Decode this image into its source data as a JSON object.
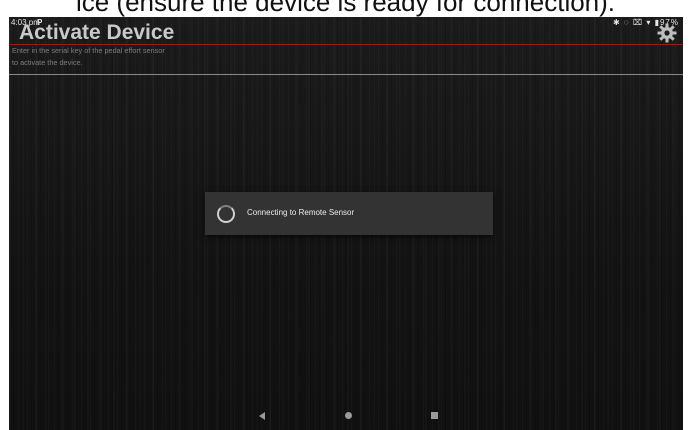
{
  "caption": {
    "text": "ice (ensure the device is ready for connection)."
  },
  "status_bar": {
    "time": "4:03 pm",
    "app_glyph": "P",
    "icons": "✱ ◌ ⌧ ▾ ▮97%"
  },
  "header": {
    "title": "Activate Device",
    "settings_icon": "gear-icon"
  },
  "instruction": {
    "line1": "Enter in the serial key of the pedal effort sensor",
    "line2": "to activate the device."
  },
  "dialog": {
    "message": "Connecting to Remote Sensor"
  },
  "nav": {
    "back_icon": "back-triangle-icon",
    "home_icon": "home-circle-icon",
    "recent_icon": "recent-square-icon"
  },
  "colors": {
    "accent_rule": "#9b1c1c",
    "background": "#151515",
    "dialog_bg": "#333333"
  }
}
